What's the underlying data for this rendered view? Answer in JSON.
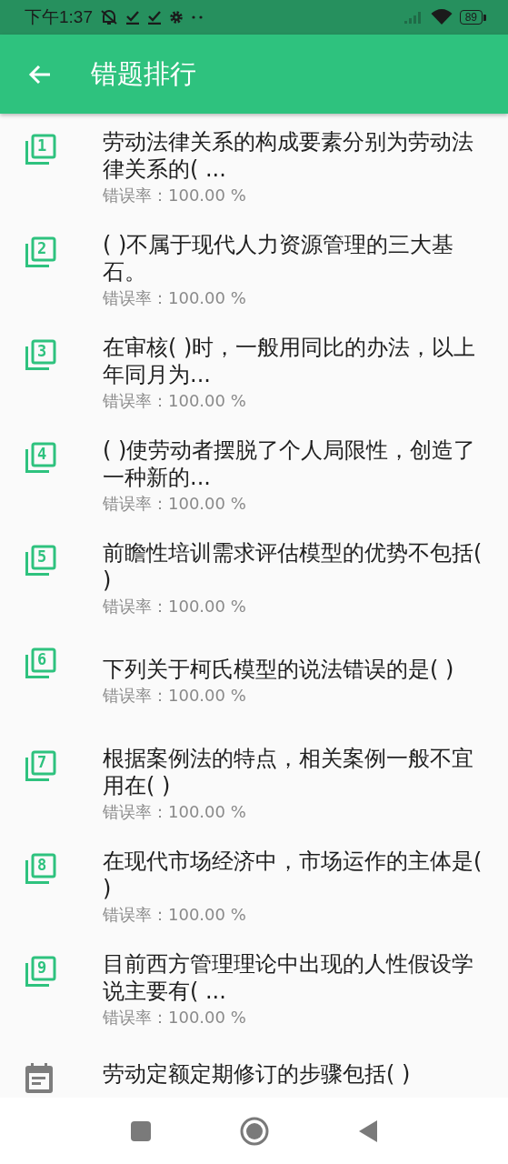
{
  "status_bar": {
    "time": "下午1:37",
    "battery": "89"
  },
  "app_bar": {
    "title": "错题排行"
  },
  "items": [
    {
      "kind": "ranked",
      "number": "1",
      "title": "劳动法律关系的构成要素分别为劳动法律关系的(   ...",
      "rate": "错误率：100.00 %"
    },
    {
      "kind": "ranked",
      "number": "2",
      "title": "(   )不属于现代人力资源管理的三大基石。",
      "rate": "错误率：100.00 %"
    },
    {
      "kind": "ranked",
      "number": "3",
      "title": "在审核(   )时，一般用同比的办法，以上年同月为...",
      "rate": "错误率：100.00 %"
    },
    {
      "kind": "ranked",
      "number": "4",
      "title": "(   )使劳动者摆脱了个人局限性，创造了一种新的...",
      "rate": "错误率：100.00 %"
    },
    {
      "kind": "ranked",
      "number": "5",
      "title": "前瞻性培训需求评估模型的优势不包括(   )",
      "rate": "错误率：100.00 %"
    },
    {
      "kind": "ranked",
      "number": "6",
      "title": "下列关于柯氏模型的说法错误的是(   )",
      "rate": "错误率：100.00 %"
    },
    {
      "kind": "ranked",
      "number": "7",
      "title": "根据案例法的特点，相关案例一般不宜用在(   )",
      "rate": "错误率：100.00 %"
    },
    {
      "kind": "ranked",
      "number": "8",
      "title": "在现代市场经济中，市场运作的主体是(   )",
      "rate": "错误率：100.00 %"
    },
    {
      "kind": "ranked",
      "number": "9",
      "title": "目前西方管理理论中出现的人性假设学说主要有(   ...",
      "rate": "错误率：100.00 %"
    },
    {
      "kind": "other",
      "title": "劳动定额定期修订的步骤包括(   )"
    }
  ]
}
